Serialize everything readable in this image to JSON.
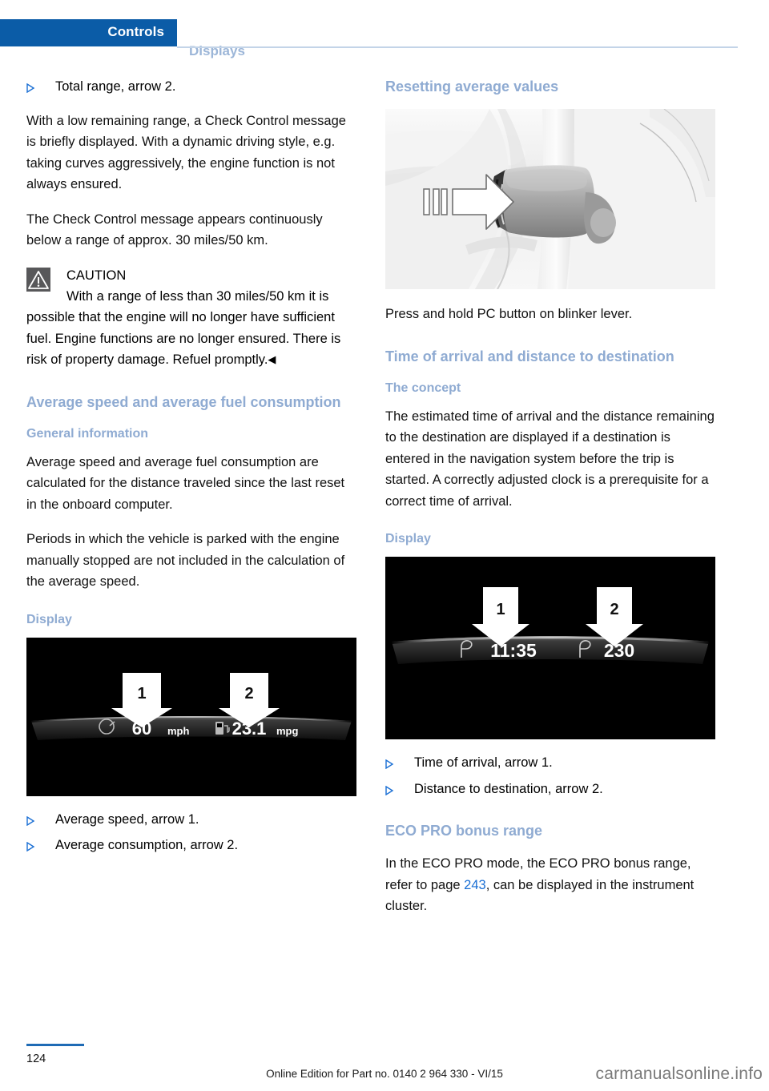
{
  "header": {
    "active_tab": "Controls",
    "inactive_tab": "Displays",
    "accent_color": "#0b5ca7",
    "inactive_color": "#9cb6d8"
  },
  "left_column": {
    "bullet_top": "Total range, arrow 2.",
    "para_1": "With a low remaining range, a Check Control message is briefly displayed. With a dynamic driving style, e.g. taking curves aggressively, the engine function is not always ensured.",
    "para_2": "The Check Control message appears continuously below a range of approx. 30 miles/50 km.",
    "caution": {
      "title": "CAUTION",
      "text": "With a range of less than 30 miles/50 km it is possible that the engine will no longer have sufficient fuel. Engine functions are no longer ensured. There is risk of property damage. Refuel promptly.",
      "endmark": "◀",
      "icon": "warning-triangle-icon",
      "icon_bg": "#58585a"
    },
    "heading_average": "Average speed and average fuel consumption",
    "sub_general": "General information",
    "para_3": "Average speed and average fuel consumption are calculated for the distance traveled since the last reset in the onboard computer.",
    "para_4": "Periods in which the vehicle is parked with the engine manually stopped are not included in the calculation of the average speed.",
    "sub_display": "Display",
    "cluster": {
      "callout_1": "1",
      "callout_2": "2",
      "value_1": "60",
      "unit_1": "mph",
      "value_2": "23.1",
      "unit_2": "mpg",
      "icon_1": "speedometer-icon",
      "icon_2": "fuel-pump-icon"
    },
    "bullets": [
      "Average speed, arrow 1.",
      "Average consumption, arrow 2."
    ]
  },
  "right_column": {
    "heading_resetting": "Resetting average values",
    "photo_caption_alt": "blinker-lever-press-illustration",
    "para_press": "Press and hold PC button on blinker lever.",
    "heading_arrival": "Time of arrival and distance to destination",
    "sub_concept": "The concept",
    "para_concept": "The estimated time of arrival and the distance remaining to the destination are displayed if a destination is entered in the navigation system before the trip is started. A correctly adjusted clock is a prerequisite for a correct time of arrival.",
    "sub_display": "Display",
    "cluster": {
      "callout_1": "1",
      "callout_2": "2",
      "value_1": "11:35",
      "value_2": "230",
      "icon_1": "destination-flag-icon",
      "icon_2": "destination-flag-icon"
    },
    "bullets": [
      "Time of arrival, arrow 1.",
      "Distance to destination, arrow 2."
    ],
    "heading_eco": "ECO PRO bonus range",
    "para_eco_before": "In the ECO PRO mode, the ECO PRO bonus range, refer to page ",
    "para_eco_link": "243",
    "para_eco_after": ", can be displayed in the instrument cluster."
  },
  "footer": {
    "page_number": "124",
    "edition": "Online Edition for Part no. 0140 2 964 330 - VI/15",
    "watermark": "carmanualsonline.info"
  }
}
